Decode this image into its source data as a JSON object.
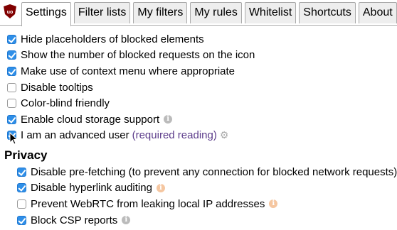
{
  "tabs": [
    {
      "label": "Settings",
      "active": true
    },
    {
      "label": "Filter lists",
      "active": false
    },
    {
      "label": "My filters",
      "active": false
    },
    {
      "label": "My rules",
      "active": false
    },
    {
      "label": "Whitelist",
      "active": false
    },
    {
      "label": "Shortcuts",
      "active": false
    },
    {
      "label": "About",
      "active": false
    }
  ],
  "settings": [
    {
      "label": "Hide placeholders of blocked elements",
      "checked": true
    },
    {
      "label": "Show the number of blocked requests on the icon",
      "checked": true
    },
    {
      "label": "Make use of context menu where appropriate",
      "checked": true
    },
    {
      "label": "Disable tooltips",
      "checked": false
    },
    {
      "label": "Color-blind friendly",
      "checked": false
    },
    {
      "label": "Enable cloud storage support",
      "checked": true,
      "info": true
    },
    {
      "label": "I am an advanced user",
      "checked": true,
      "link": "(required reading)",
      "gears": true
    }
  ],
  "privacy": {
    "title": "Privacy",
    "items": [
      {
        "label": "Disable pre-fetching (to prevent any connection for blocked network requests)",
        "checked": true,
        "info": "gray"
      },
      {
        "label": "Disable hyperlink auditing",
        "checked": true,
        "info": "orange"
      },
      {
        "label": "Prevent WebRTC from leaking local IP addresses",
        "checked": false,
        "info": "orange"
      },
      {
        "label": "Block CSP reports",
        "checked": true,
        "info": "gray"
      }
    ]
  },
  "colors": {
    "accent": "#2f8fe8",
    "logo": "#800000",
    "link": "#5b3b8a"
  },
  "icons": {
    "logo": "ublock-shield-icon",
    "info": "info-icon",
    "gears": "gears-icon",
    "cursor": "mouse-pointer-icon"
  }
}
